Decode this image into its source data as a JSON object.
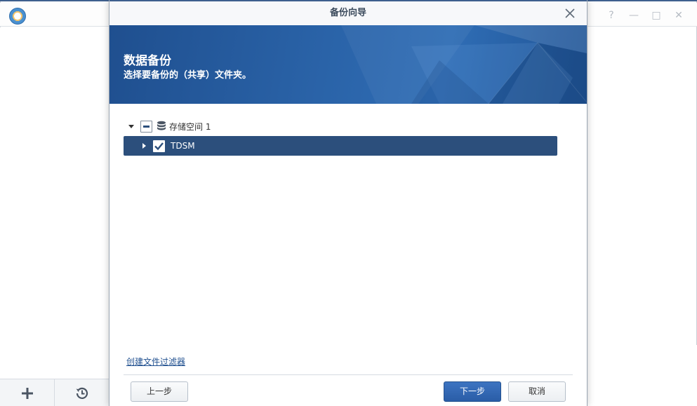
{
  "dialog": {
    "title": "备份向导",
    "banner_title": "数据备份",
    "banner_subtitle": "选择要备份的（共享）文件夹。"
  },
  "tree": {
    "root": {
      "label": "存储空间 1",
      "state": "partial",
      "icon": "database-icon"
    },
    "children": [
      {
        "label": "TDSM",
        "state": "checked",
        "selected": true
      }
    ]
  },
  "footer": {
    "filter_link": "创建文件过滤器",
    "prev_label": "上一步",
    "next_label": "下一步",
    "cancel_label": "取消"
  },
  "background_app": {
    "window_controls": [
      "help-icon",
      "minimize-icon",
      "maximize-icon",
      "close-icon"
    ],
    "bottom_buttons": [
      "add-icon",
      "history-icon"
    ]
  },
  "colors": {
    "accent": "#2c4f7c",
    "primary_button": "#2f64ae",
    "banner": "#2a63a8",
    "link": "#1f4f8f"
  }
}
